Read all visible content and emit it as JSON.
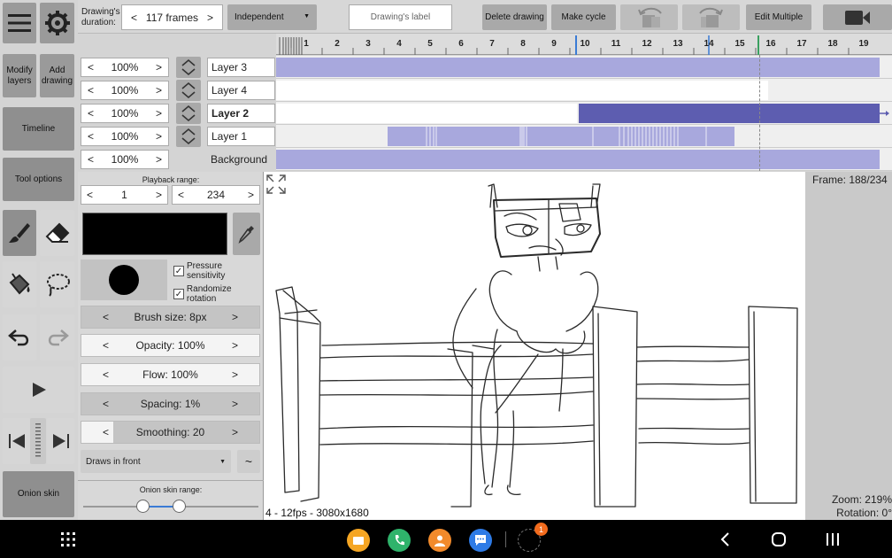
{
  "left": {
    "modify_layers": "Modify layers",
    "add_drawing": "Add drawing",
    "timeline": "Timeline",
    "tool_options": "Tool options",
    "onion_skin": "Onion skin"
  },
  "top": {
    "duration_label": "Drawing's duration:",
    "duration_value": "117 frames",
    "mode": "Independent",
    "label_placeholder": "Drawing's label",
    "delete_drawing": "Delete drawing",
    "make_cycle": "Make cycle",
    "edit_multiple": "Edit Multiple"
  },
  "ruler": {
    "frames": [
      "1",
      "2",
      "3",
      "4",
      "5",
      "6",
      "7",
      "8",
      "9",
      "10",
      "11",
      "12",
      "13",
      "14",
      "15",
      "16",
      "17",
      "18",
      "19"
    ]
  },
  "layers": [
    {
      "opacity": "100%",
      "name": "Layer 3"
    },
    {
      "opacity": "100%",
      "name": "Layer 4"
    },
    {
      "opacity": "100%",
      "name": "Layer 2"
    },
    {
      "opacity": "100%",
      "name": "Layer 1"
    },
    {
      "opacity": "100%",
      "name": "Background"
    }
  ],
  "panel": {
    "playback_range_label": "Playback range:",
    "range_start": "1",
    "range_end": "234",
    "pressure_sensitivity": "Pressure sensitivity",
    "randomize_rotation": "Randomize rotation",
    "brush_size": "Brush size: 8px",
    "opacity": "Opacity: 100%",
    "flow": "Flow: 100%",
    "spacing": "Spacing: 1%",
    "smoothing": "Smoothing: 20",
    "draws_in_front": "Draws in front",
    "onion_range_label": "Onion skin range:",
    "swatch_color": "#000000"
  },
  "canvas": {
    "status": "4 - 12fps - 3080x1680",
    "frame": "Frame: 188/234",
    "zoom": "Zoom: 219%",
    "rotation": "Rotation: 0°"
  },
  "nav": {
    "badge": "1"
  },
  "colors": {
    "accent_bar": "#a8a8dd",
    "accent_bar_selected": "#5d5db0",
    "nav_bg": "#000000"
  }
}
